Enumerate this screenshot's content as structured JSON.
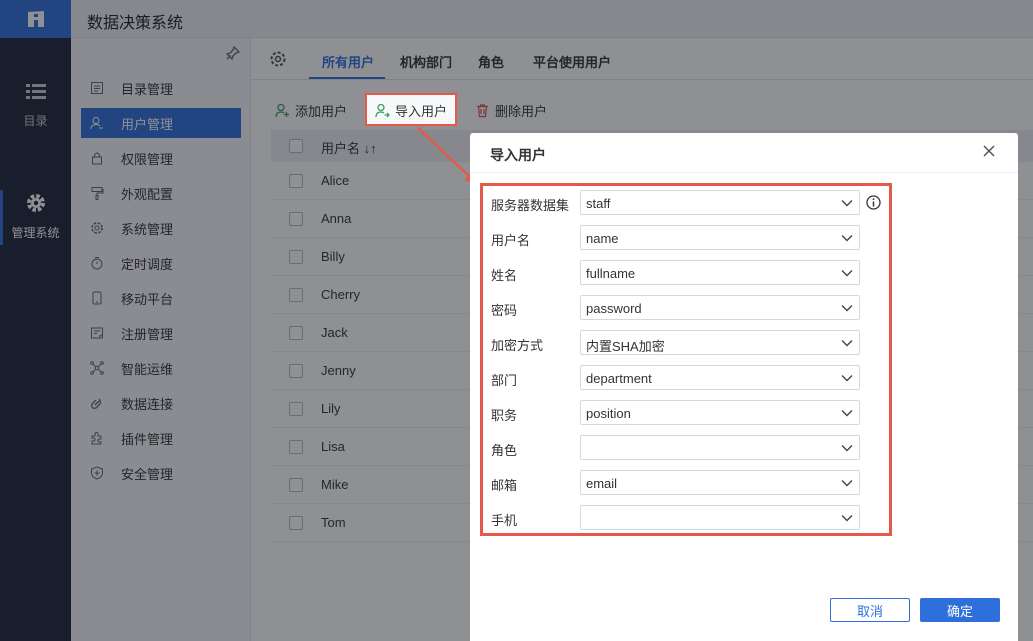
{
  "app": {
    "title": "数据决策系统"
  },
  "leftnav": {
    "items": [
      {
        "label": "目录",
        "icon": "list-icon"
      },
      {
        "label": "管理系统",
        "icon": "gear-icon"
      }
    ]
  },
  "sidebar": {
    "items": [
      {
        "label": "目录管理",
        "icon": "catalog-icon"
      },
      {
        "label": "用户管理",
        "icon": "user-icon",
        "active": true
      },
      {
        "label": "权限管理",
        "icon": "lock-icon"
      },
      {
        "label": "外观配置",
        "icon": "brush-icon"
      },
      {
        "label": "系统管理",
        "icon": "settings-icon"
      },
      {
        "label": "定时调度",
        "icon": "timer-icon"
      },
      {
        "label": "移动平台",
        "icon": "mobile-icon"
      },
      {
        "label": "注册管理",
        "icon": "register-icon"
      },
      {
        "label": "智能运维",
        "icon": "network-icon"
      },
      {
        "label": "数据连接",
        "icon": "link-icon"
      },
      {
        "label": "插件管理",
        "icon": "plugin-icon"
      },
      {
        "label": "安全管理",
        "icon": "shield-icon"
      }
    ]
  },
  "tabs": [
    {
      "label": "所有用户",
      "active": true
    },
    {
      "label": "机构部门"
    },
    {
      "label": "角色"
    },
    {
      "label": "平台使用用户"
    }
  ],
  "toolbar": {
    "add_label": "添加用户",
    "import_label": "导入用户",
    "delete_label": "删除用户"
  },
  "table": {
    "header": "用户名 ↓↑",
    "rows": [
      "Alice",
      "Anna",
      "Billy",
      "Cherry",
      "Jack",
      "Jenny",
      "Lily",
      "Lisa",
      "Mike",
      "Tom"
    ]
  },
  "dialog": {
    "title": "导入用户",
    "fields": [
      {
        "label": "服务器数据集",
        "value": "staff"
      },
      {
        "label": "用户名",
        "value": "name"
      },
      {
        "label": "姓名",
        "value": "fullname"
      },
      {
        "label": "密码",
        "value": "password"
      },
      {
        "label": "加密方式",
        "value": "内置SHA加密"
      },
      {
        "label": "部门",
        "value": "department"
      },
      {
        "label": "职务",
        "value": "position"
      },
      {
        "label": "角色",
        "value": ""
      },
      {
        "label": "邮箱",
        "value": "email"
      },
      {
        "label": "手机",
        "value": ""
      }
    ],
    "cancel_label": "取消",
    "ok_label": "确定"
  },
  "colors": {
    "accent": "#2f6fdb",
    "highlight": "#e35a4a",
    "nav_bg": "#1c2538"
  }
}
